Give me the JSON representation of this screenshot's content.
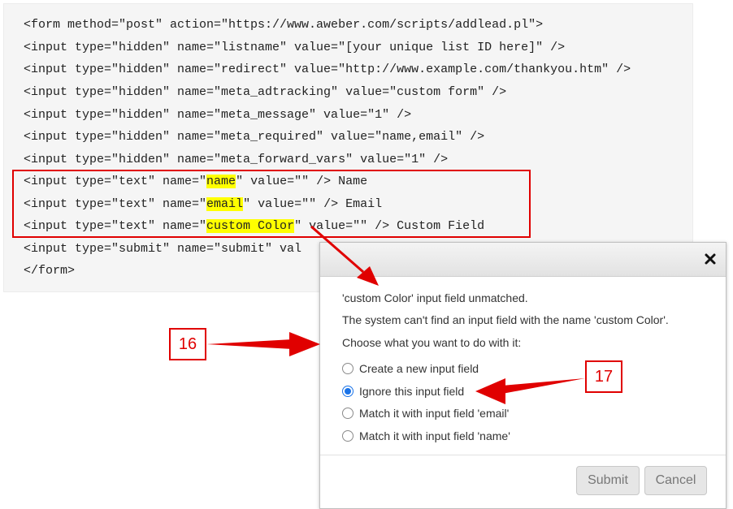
{
  "code": {
    "lines": [
      "<form method=\"post\" action=\"https://www.aweber.com/scripts/addlead.pl\">",
      "<input type=\"hidden\" name=\"listname\" value=\"[your unique list ID here]\" />",
      "<input type=\"hidden\" name=\"redirect\" value=\"http://www.example.com/thankyou.htm\" />",
      "<input type=\"hidden\" name=\"meta_adtracking\" value=\"custom form\" />",
      "<input type=\"hidden\" name=\"meta_message\" value=\"1\" />",
      "<input type=\"hidden\" name=\"meta_required\" value=\"name,email\" />",
      "<input type=\"hidden\" name=\"meta_forward_vars\" value=\"1\" />"
    ],
    "highlighted_lines": [
      {
        "pre": "<input type=\"text\" name=\"",
        "hl": "name",
        "post": "\" value=\"\" /> Name"
      },
      {
        "pre": "<input type=\"text\" name=\"",
        "hl": "email",
        "post": "\" value=\"\" /> Email"
      },
      {
        "pre": "<input type=\"text\" name=\"",
        "hl": "custom Color",
        "post": "\" value=\"\" /> Custom Field"
      }
    ],
    "submit_line": "<input type=\"submit\" name=\"submit\" val",
    "close_line": "</form>"
  },
  "dialog": {
    "title_msg": "'custom Color' input field unmatched.",
    "detail_msg": "The system can't find an input field with the name 'custom Color'.",
    "prompt_msg": "Choose what you want to do with it:",
    "options": [
      {
        "label": "Create a new input field",
        "checked": false
      },
      {
        "label": "Ignore this input field",
        "checked": true
      },
      {
        "label": "Match it with input field 'email'",
        "checked": false
      },
      {
        "label": "Match it with input field 'name'",
        "checked": false
      }
    ],
    "submit_label": "Submit",
    "cancel_label": "Cancel"
  },
  "callouts": {
    "step_a": "16",
    "step_b": "17"
  },
  "colors": {
    "annotation_red": "#e00000",
    "highlight_yellow": "#ffff00",
    "radio_blue": "#1a73e8"
  }
}
